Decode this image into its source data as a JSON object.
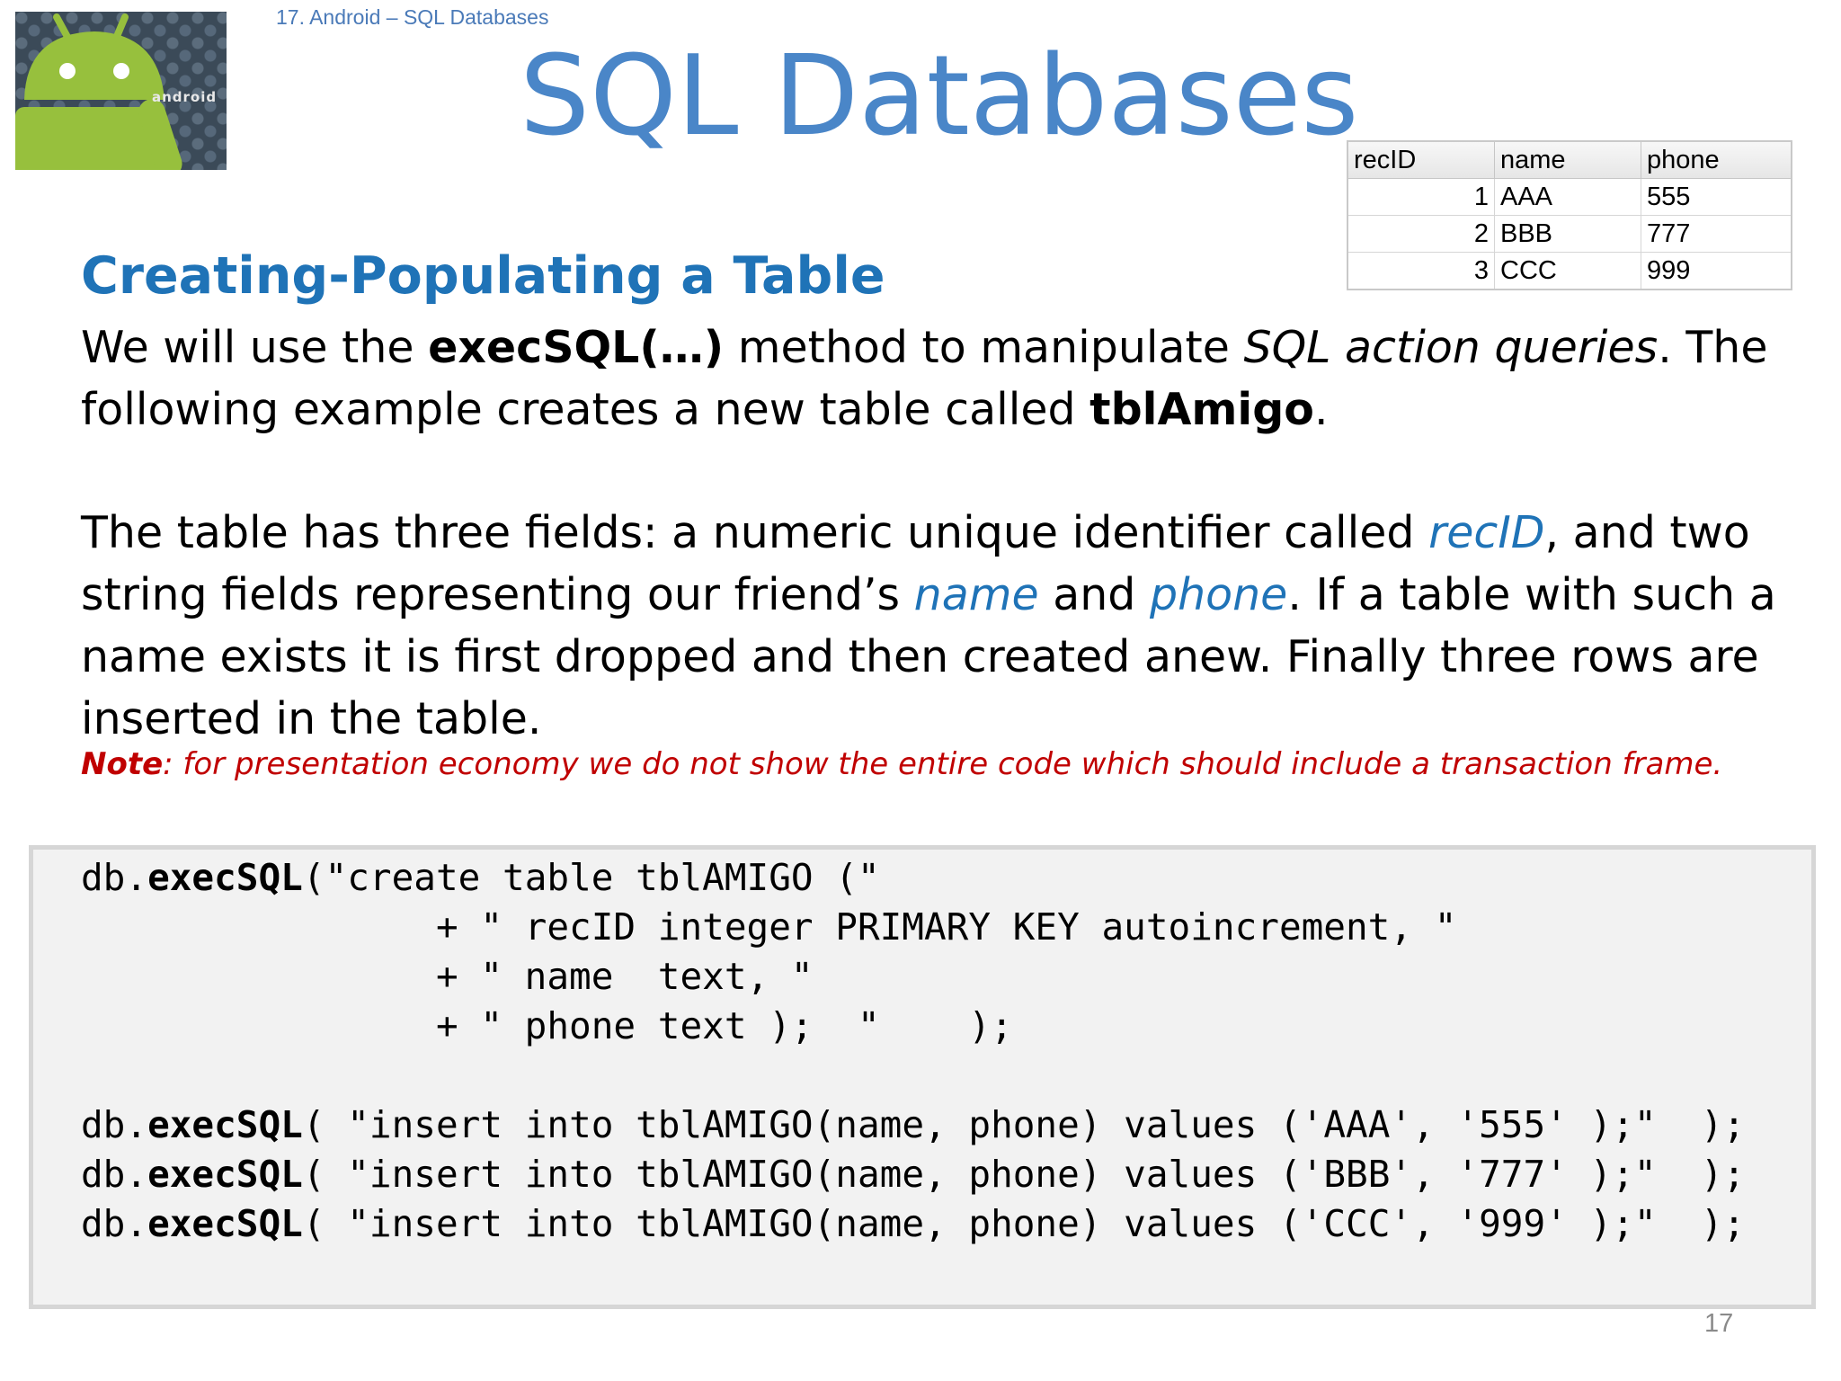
{
  "header": {
    "running_title": "17. Android – SQL Databases",
    "title": "SQL Databases",
    "logo_text": "android",
    "page_number": "17"
  },
  "table": {
    "columns": [
      "recID",
      "name",
      "phone"
    ],
    "rows": [
      [
        "1",
        "AAA",
        "555"
      ],
      [
        "2",
        "BBB",
        "777"
      ],
      [
        "3",
        "CCC",
        "999"
      ]
    ]
  },
  "section": {
    "title": "Creating-Populating a Table",
    "p1": {
      "a": "We will use the ",
      "b": "execSQL(…)",
      "c": " method to manipulate ",
      "d": "SQL action queries",
      "e": ". The following example creates a new table called ",
      "f": "tblAmigo",
      "g": "."
    },
    "p2": {
      "a": "The table has three fields: a numeric unique identifier called ",
      "b": "recID",
      "c": ", and two string fields representing our friend’s ",
      "d": "name",
      "e": " and ",
      "f": "phone",
      "g": ". If a table with such a name exists it is first dropped and then created anew. Finally three rows are inserted in the table."
    },
    "note": {
      "label": "Note",
      "text": ": for presentation economy we do not show the entire code which should include a transaction frame."
    }
  },
  "code": {
    "l1": {
      "obj": "db.",
      "method": "execSQL",
      "rest": "(\"create table tblAMIGO (\""
    },
    "l2": "                + \" recID integer PRIMARY KEY autoincrement, \"",
    "l3": "                + \" name  text, \"",
    "l4": "                + \" phone text );  \"    );",
    "l5": {
      "obj": "db.",
      "method": "execSQL",
      "rest": "( \"insert into tblAMIGO(name, phone) values ('AAA', '555' );\"  );"
    },
    "l6": {
      "obj": "db.",
      "method": "execSQL",
      "rest": "( \"insert into tblAMIGO(name, phone) values ('BBB', '777' );\"  );"
    },
    "l7": {
      "obj": "db.",
      "method": "execSQL",
      "rest": "( \"insert into tblAMIGO(name, phone) values ('CCC', '999' );\"  );"
    }
  }
}
